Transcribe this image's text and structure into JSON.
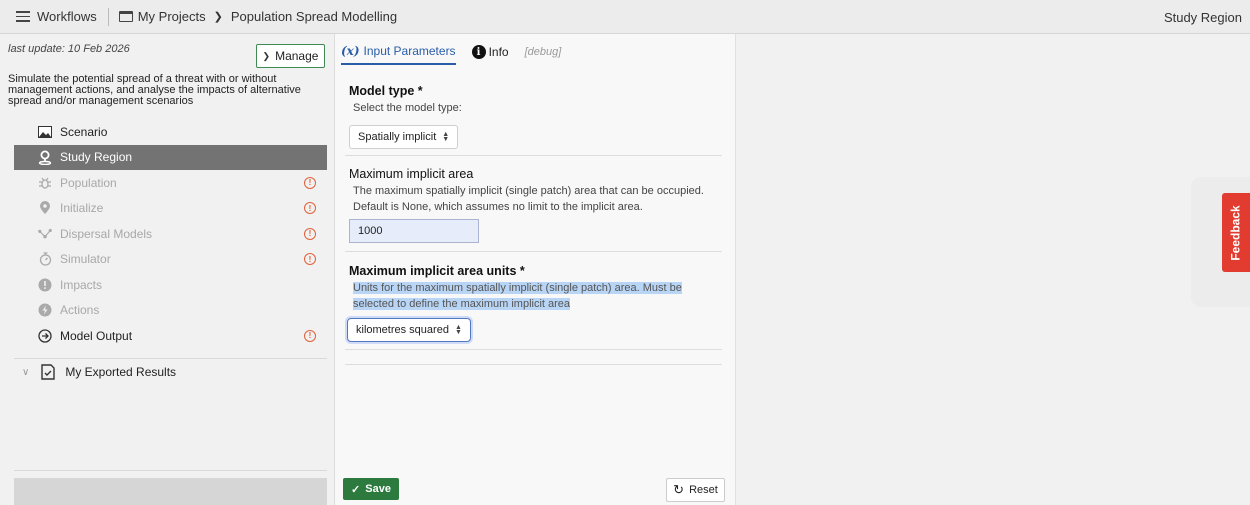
{
  "topbar": {
    "workflows": "Workflows",
    "my_projects": "My Projects",
    "project": "Population Spread Modelling",
    "right": "Study Region"
  },
  "sidebar": {
    "last_update": "last update: 10 Feb 2026",
    "manage": "Manage",
    "description": "Simulate the potential spread of a threat with or without management actions, and analyse the impacts of alternative spread and/or management scenarios",
    "items": [
      {
        "label": "Scenario",
        "icon": "image-icon",
        "state": "normal",
        "warning": false
      },
      {
        "label": "Study Region",
        "icon": "map-pin-icon",
        "state": "active",
        "warning": false
      },
      {
        "label": "Population",
        "icon": "bug-icon",
        "state": "disabled",
        "warning": true
      },
      {
        "label": "Initialize",
        "icon": "location-icon",
        "state": "disabled",
        "warning": true
      },
      {
        "label": "Dispersal Models",
        "icon": "network-icon",
        "state": "disabled",
        "warning": true
      },
      {
        "label": "Simulator",
        "icon": "stopwatch-icon",
        "state": "disabled",
        "warning": true
      },
      {
        "label": "Impacts",
        "icon": "alert-circle-icon",
        "state": "disabled",
        "warning": false
      },
      {
        "label": "Actions",
        "icon": "lightning-icon",
        "state": "disabled",
        "warning": false
      },
      {
        "label": "Model Output",
        "icon": "arrow-circle-icon",
        "state": "normal",
        "warning": true
      }
    ],
    "exported": "My Exported Results"
  },
  "tabs": {
    "input_params_icon": "(x)",
    "input_params": "Input Parameters",
    "info": "Info",
    "debug": "[debug]"
  },
  "form": {
    "model_type": {
      "title": "Model type *",
      "help": "Select the model type:",
      "value": "Spatially implicit"
    },
    "max_area": {
      "title": "Maximum implicit area",
      "help": "The maximum spatially implicit (single patch) area that can be occupied. Default is None, which assumes no limit to the implicit area.",
      "value": "1000"
    },
    "max_area_units": {
      "title": "Maximum implicit area units *",
      "help": "Units for the maximum spatially implicit (single patch) area. Must be selected to define the maximum implicit area",
      "value": "kilometres squared"
    }
  },
  "buttons": {
    "save": "Save",
    "reset": "Reset"
  },
  "feedback": "Feedback",
  "colors": {
    "accent_blue": "#2a5da8",
    "save_green": "#2d7a3e",
    "feedback_red": "#e23b2f",
    "warning_orange": "#e0613a",
    "active_nav": "#737373"
  }
}
